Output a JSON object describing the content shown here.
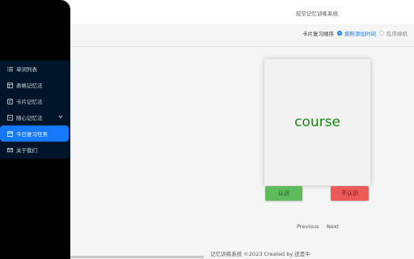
{
  "header": {
    "app_title": "挖空记忆训练系统"
  },
  "sidebar": {
    "items": [
      {
        "label": "单词列表",
        "icon": "list-icon",
        "active": false
      },
      {
        "label": "表格记忆法",
        "icon": "table-icon",
        "active": false
      },
      {
        "label": "卡片记忆法",
        "icon": "card-icon",
        "active": false
      },
      {
        "label": "随心记忆法",
        "icon": "shuffle-icon",
        "active": false,
        "has_submenu": true
      },
      {
        "label": "今日复习任务",
        "icon": "calendar-icon",
        "active": true
      },
      {
        "label": "关于我们",
        "icon": "mail-icon",
        "active": false
      }
    ]
  },
  "order": {
    "label": "卡片复习顺序",
    "options": [
      {
        "label": "按照添加时间",
        "selected": true
      },
      {
        "label": "乱序顺机",
        "selected": false
      }
    ]
  },
  "card": {
    "word": "course"
  },
  "actions": {
    "know_label": "认识",
    "unknown_label": "不认识"
  },
  "pagination": {
    "prev_label": "Previous",
    "next_label": "Next"
  },
  "footer": {
    "text": "记忆训练系统 ©2023 Created by 还是牛"
  },
  "colors": {
    "accent": "#1677ff",
    "word": "#108a0b",
    "know": "#5ebc5c",
    "unknown": "#ec5a57",
    "sidebar": "#001529"
  }
}
